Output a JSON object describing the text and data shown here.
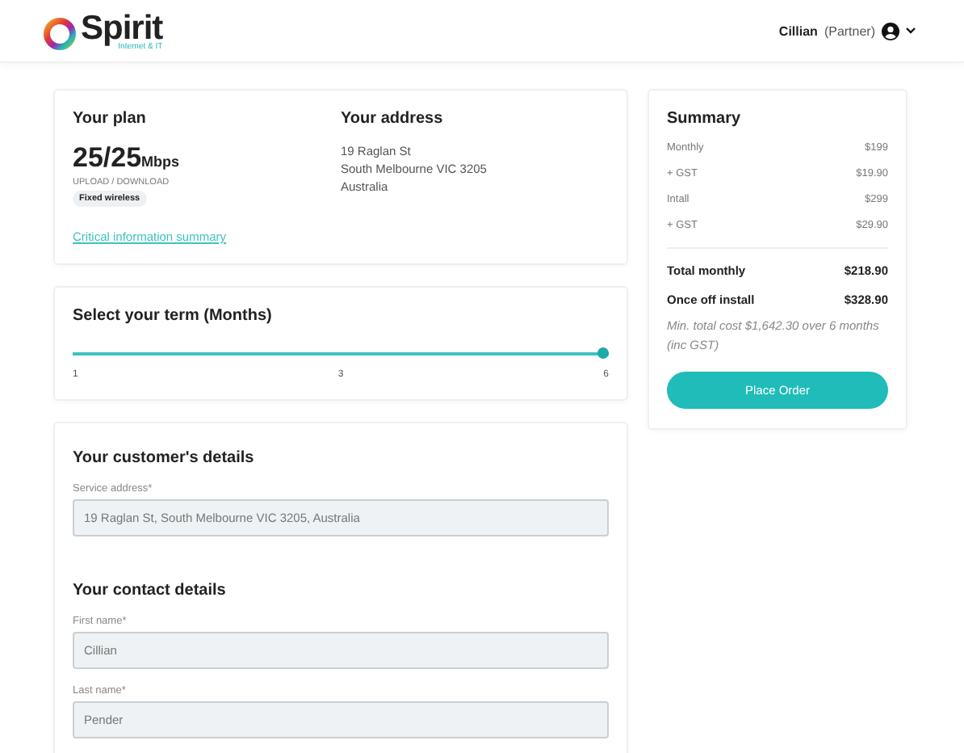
{
  "header": {
    "brand": "Spirit",
    "tagline": "Internet & IT",
    "user_name": "Cillian",
    "user_role": "(Partner)"
  },
  "plan": {
    "title": "Your plan",
    "speed": "25/25",
    "unit": "Mbps",
    "speed_caption": "UPLOAD / DOWNLOAD",
    "badge": "Fixed wireless",
    "link": "Critical information summary"
  },
  "address": {
    "title": "Your address",
    "lines": [
      "19 Raglan St",
      "South Melbourne VIC 3205",
      "Australia"
    ]
  },
  "term": {
    "title": "Select your term (Months)",
    "level": 1,
    "ticks": [
      "1",
      "3",
      "6"
    ]
  },
  "customer": {
    "title": "Your customer's details",
    "fields": [
      {
        "label": "Service address*",
        "value": "19 Raglan St, South Melbourne VIC 3205, Australia"
      }
    ]
  },
  "contact": {
    "title": "Your contact details",
    "fields": [
      {
        "label": "First name*",
        "value": "Cillian"
      },
      {
        "label": "Last name*",
        "value": "Pender"
      }
    ]
  },
  "summary": {
    "title": "Summary",
    "rows": [
      {
        "kind": "item",
        "label": "Monthly",
        "amount": "$199"
      },
      {
        "kind": "item",
        "label": "+ GST",
        "amount": "$19.90"
      },
      {
        "kind": "item",
        "label": "Intall",
        "amount": "$299"
      },
      {
        "kind": "item",
        "label": "+ GST",
        "amount": "$29.90"
      },
      {
        "kind": "total",
        "label": "Total monthly",
        "amount": "$218.90"
      },
      {
        "kind": "total",
        "label": "Once off install",
        "amount": "$328.90"
      }
    ],
    "note": "Min. total cost $1,642.30 over 6 months (inc GST)",
    "button": "Place Order"
  }
}
